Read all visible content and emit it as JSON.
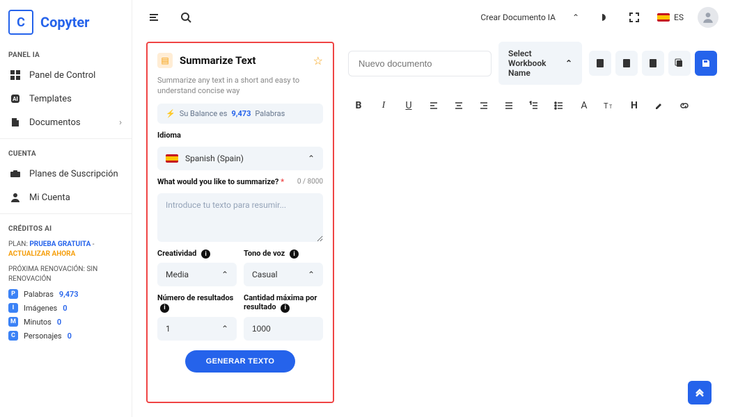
{
  "brand": {
    "initial": "C",
    "name": "Copyter"
  },
  "sidebar": {
    "section_panel": "PANEL IA",
    "items_panel": [
      {
        "label": "Panel de Control"
      },
      {
        "label": "Templates"
      },
      {
        "label": "Documentos"
      }
    ],
    "section_account": "CUENTA",
    "items_account": [
      {
        "label": "Planes de Suscripción"
      },
      {
        "label": "Mi Cuenta"
      }
    ],
    "section_credits": "CRÉDITOS AI",
    "plan_prefix": "PLAN:",
    "plan_name": "PRUEBA GRATUITA",
    "plan_sep": " - ",
    "plan_upgrade": "ACTUALIZAR AHORA",
    "renewal_prefix": "PRÓXIMA RENOVACIÓN:",
    "renewal_value": "SIN RENOVACIÓN",
    "credits": [
      {
        "label": "Palabras",
        "value": "9,473"
      },
      {
        "label": "Imágenes",
        "value": "0"
      },
      {
        "label": "Minutos",
        "value": "0"
      },
      {
        "label": "Personajes",
        "value": "0"
      }
    ]
  },
  "topbar": {
    "create_doc": "Crear Documento IA",
    "lang_code": "ES"
  },
  "form": {
    "title": "Summarize Text",
    "desc": "Summarize any text in a short and easy to understand concise way",
    "balance_prefix": "Su Balance es",
    "balance_value": "9,473",
    "balance_suffix": "Palabras",
    "language_label": "Idioma",
    "language_value": "Spanish (Spain)",
    "summarize_label": "What would you like to summarize?",
    "summarize_counter": "0 / 8000",
    "summarize_placeholder": "Introduce tu texto para resumir...",
    "creativity_label": "Creatividad",
    "creativity_value": "Media",
    "tone_label": "Tono de voz",
    "tone_value": "Casual",
    "results_label": "Número de resultados",
    "results_value": "1",
    "maxlen_label": "Cantidad máxima por resultado",
    "maxlen_value": "1000",
    "generate_btn": "GENERAR TEXTO"
  },
  "editor": {
    "doc_placeholder": "Nuevo documento",
    "workbook_label": "Select Workbook Name"
  }
}
